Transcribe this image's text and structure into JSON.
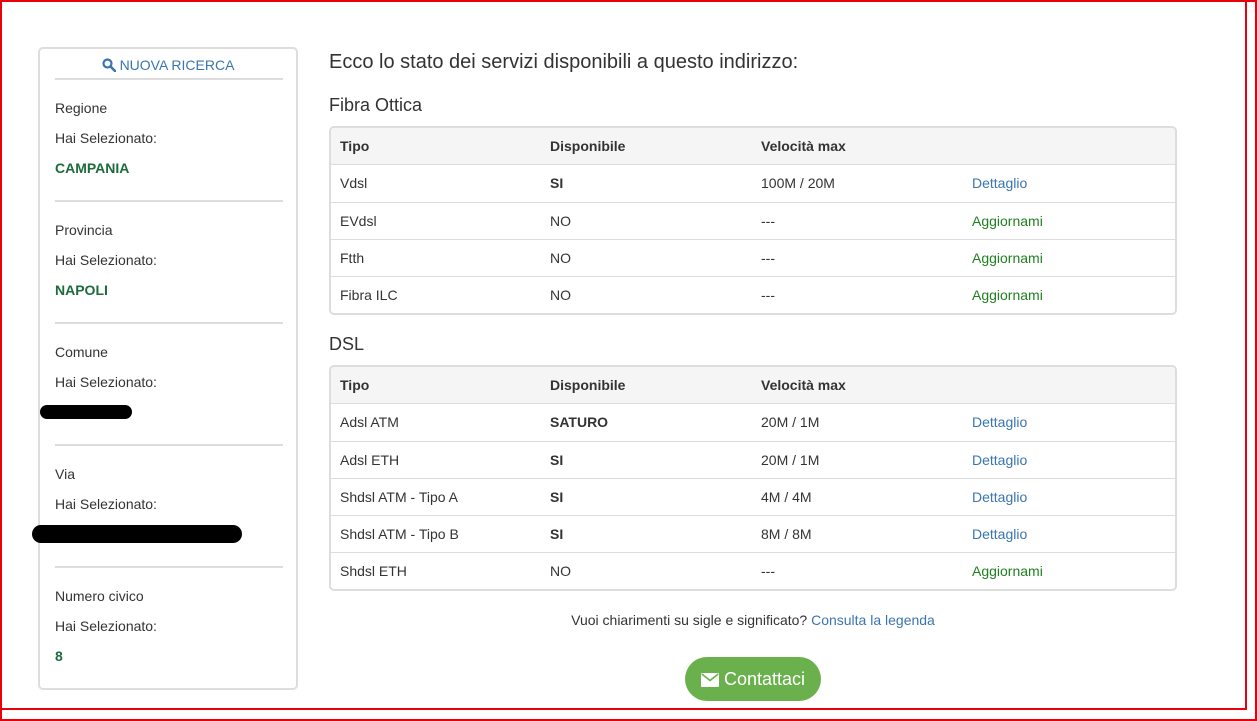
{
  "sidebar": {
    "new_search_label": "NUOVA RICERCA",
    "selected_prefix": "Hai Selezionato:",
    "fields": [
      {
        "label": "Regione",
        "value": "CAMPANIA"
      },
      {
        "label": "Provincia",
        "value": "NAPOLI"
      },
      {
        "label": "Comune",
        "value": ""
      },
      {
        "label": "Via",
        "value": ""
      },
      {
        "label": "Numero civico",
        "value": "8"
      }
    ]
  },
  "main": {
    "heading": "Ecco lo stato dei servizi disponibili a questo indirizzo:",
    "columns": [
      "Tipo",
      "Disponibile",
      "Velocità max"
    ],
    "sections": [
      {
        "title": "Fibra Ottica",
        "rows": [
          {
            "tipo": "Vdsl",
            "disponibile": "SI",
            "velocita": "100M / 20M",
            "action": "Dettaglio"
          },
          {
            "tipo": "EVdsl",
            "disponibile": "NO",
            "velocita": "---",
            "action": "Aggiornami"
          },
          {
            "tipo": "Ftth",
            "disponibile": "NO",
            "velocita": "---",
            "action": "Aggiornami"
          },
          {
            "tipo": "Fibra ILC",
            "disponibile": "NO",
            "velocita": "---",
            "action": "Aggiornami"
          }
        ]
      },
      {
        "title": "DSL",
        "rows": [
          {
            "tipo": "Adsl ATM",
            "disponibile": "SATURO",
            "velocita": "20M / 1M",
            "action": "Dettaglio"
          },
          {
            "tipo": "Adsl ETH",
            "disponibile": "SI",
            "velocita": "20M / 1M",
            "action": "Dettaglio"
          },
          {
            "tipo": "Shdsl ATM - Tipo A",
            "disponibile": "SI",
            "velocita": "4M / 4M",
            "action": "Dettaglio"
          },
          {
            "tipo": "Shdsl ATM - Tipo B",
            "disponibile": "SI",
            "velocita": "8M / 8M",
            "action": "Dettaglio"
          },
          {
            "tipo": "Shdsl ETH",
            "disponibile": "NO",
            "velocita": "---",
            "action": "Aggiornami"
          }
        ]
      }
    ],
    "legend_text": "Vuoi chiarimenti su sigle e significato?",
    "legend_link": "Consulta la legenda",
    "contact_label": "Contattaci"
  },
  "colors": {
    "frame": "#e8000b",
    "link": "#3a75b0",
    "green_link": "#208020",
    "selected_value": "#1d6b3a",
    "button": "#6ab04c"
  },
  "icons": {
    "new_search": "search-icon",
    "contact": "envelope-icon"
  }
}
